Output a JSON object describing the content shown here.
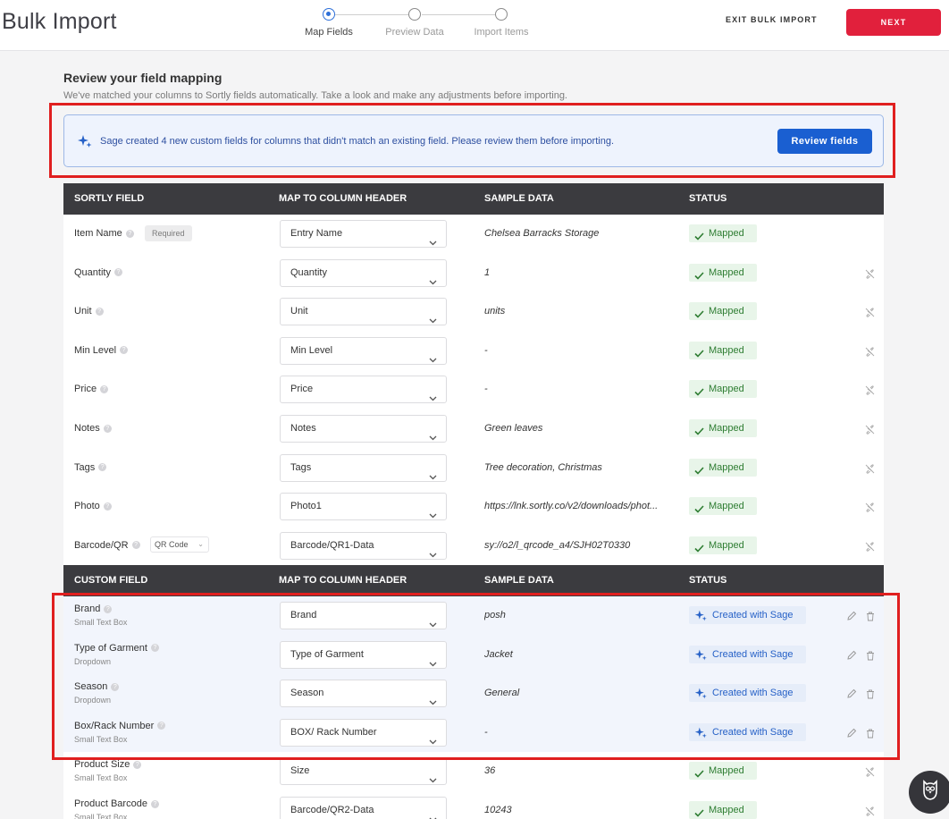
{
  "header": {
    "title": "Bulk Import",
    "steps": [
      {
        "label": "Map Fields",
        "active": true
      },
      {
        "label": "Preview Data",
        "active": false
      },
      {
        "label": "Import Items",
        "active": false
      }
    ],
    "exit_label": "EXIT BULK IMPORT",
    "next_label": "NEXT"
  },
  "section": {
    "title": "Review your field mapping",
    "subtitle": "We've matched your columns to Sortly fields automatically. Take a look and make any adjustments before importing."
  },
  "banner": {
    "message": "Sage created 4 new custom fields for columns that didn't match an existing field. Please review them before importing.",
    "button_label": "Review fields"
  },
  "sortly_table": {
    "headers": [
      "SORTLY FIELD",
      "MAP TO COLUMN HEADER",
      "SAMPLE DATA",
      "STATUS"
    ],
    "required_label": "Required",
    "qr_option": "QR Code",
    "rows": [
      {
        "field": "Item Name",
        "column": "Entry Name",
        "sample": "Chelsea Barracks Storage",
        "status": "Mapped"
      },
      {
        "field": "Quantity",
        "column": "Quantity",
        "sample": "1",
        "status": "Mapped"
      },
      {
        "field": "Unit",
        "column": "Unit",
        "sample": "units",
        "status": "Mapped"
      },
      {
        "field": "Min Level",
        "column": "Min Level",
        "sample": "-",
        "status": "Mapped"
      },
      {
        "field": "Price",
        "column": "Price",
        "sample": "-",
        "status": "Mapped"
      },
      {
        "field": "Notes",
        "column": "Notes",
        "sample": "Green leaves",
        "status": "Mapped"
      },
      {
        "field": "Tags",
        "column": "Tags",
        "sample": "Tree decoration, Christmas",
        "status": "Mapped"
      },
      {
        "field": "Photo",
        "column": "Photo1",
        "sample": "https://lnk.sortly.co/v2/downloads/phot...",
        "status": "Mapped"
      },
      {
        "field": "Barcode/QR",
        "column": "Barcode/QR1-Data",
        "sample": "sy://o2/l_qrcode_a4/SJH02T0330",
        "status": "Mapped"
      }
    ]
  },
  "custom_table": {
    "headers": [
      "CUSTOM FIELD",
      "MAP TO COLUMN HEADER",
      "SAMPLE DATA",
      "STATUS"
    ],
    "rows": [
      {
        "field": "Brand",
        "type": "Small Text Box",
        "column": "Brand",
        "sample": "posh",
        "status": "Created with Sage"
      },
      {
        "field": "Type of Garment",
        "type": "Dropdown",
        "column": "Type of Garment",
        "sample": "Jacket",
        "status": "Created with Sage"
      },
      {
        "field": "Season",
        "type": "Dropdown",
        "column": "Season",
        "sample": "General",
        "status": "Created with Sage"
      },
      {
        "field": "Box/Rack Number",
        "type": "Small Text Box",
        "column": "BOX/ Rack Number",
        "sample": "-",
        "status": "Created with Sage"
      },
      {
        "field": "Product Size",
        "type": "Small Text Box",
        "column": "Size",
        "sample": "36",
        "status": "Mapped"
      },
      {
        "field": "Product Barcode",
        "type": "Small Text Box",
        "column": "Barcode/QR2-Data",
        "sample": "10243",
        "status": "Mapped"
      }
    ]
  },
  "colors": {
    "accent_red": "#e1203c",
    "sage_blue": "#1a5fd1",
    "mapped_green": "#2e7d32",
    "table_header": "#3b3b3f"
  },
  "icons": [
    "sparkle-icon",
    "chevron-down-icon",
    "check-icon",
    "unlink-icon",
    "edit-icon",
    "trash-icon",
    "help-icon",
    "owl-icon"
  ]
}
